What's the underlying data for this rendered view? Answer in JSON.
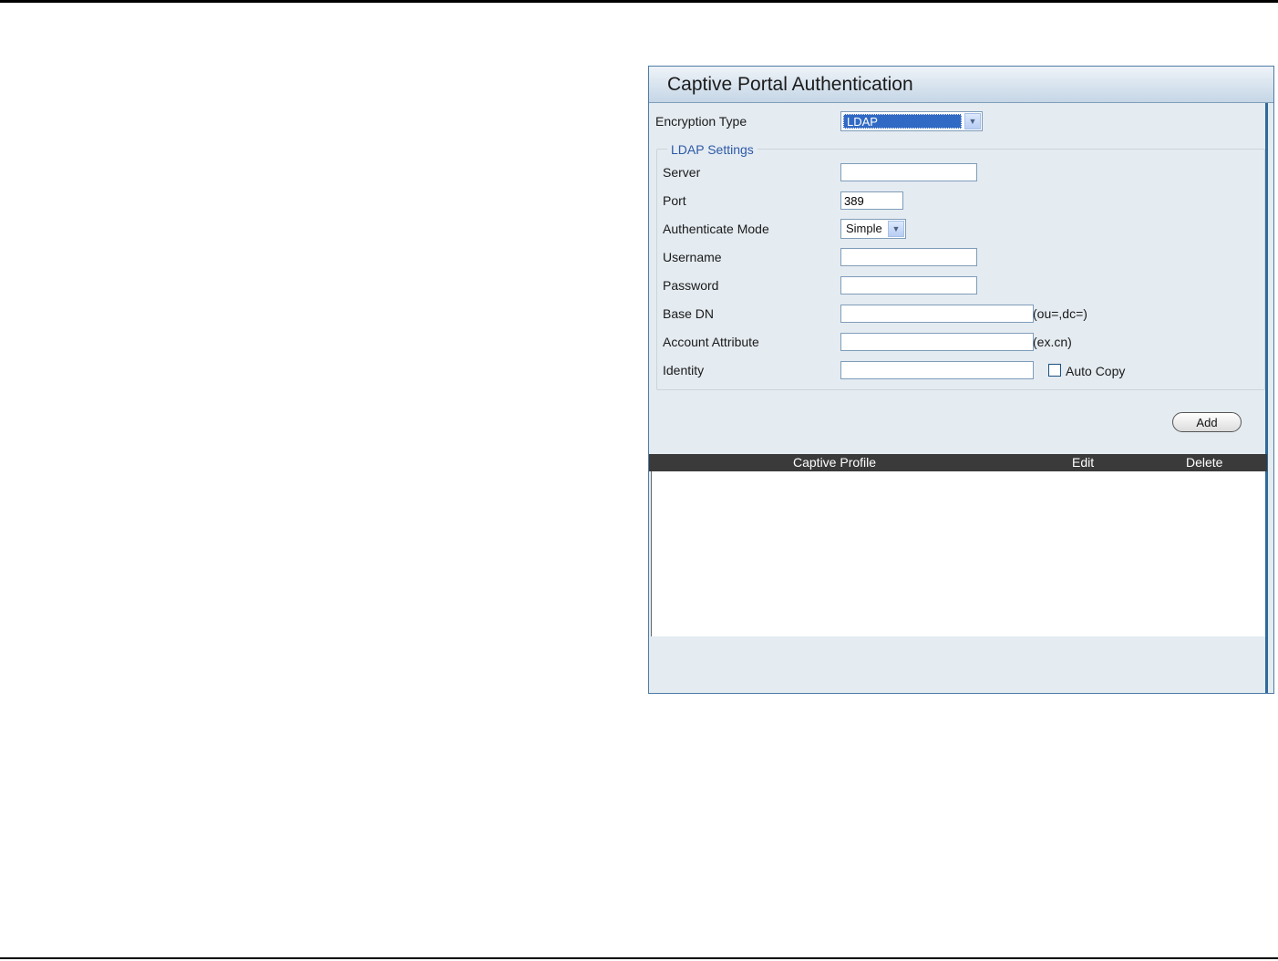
{
  "panel": {
    "title": "Captive Portal Authentication"
  },
  "encryption": {
    "label": "Encryption Type",
    "selected": "LDAP"
  },
  "ldap": {
    "legend": "LDAP Settings",
    "server": {
      "label": "Server",
      "value": ""
    },
    "port": {
      "label": "Port",
      "value": "389"
    },
    "auth_mode": {
      "label": "Authenticate Mode",
      "selected": "Simple"
    },
    "username": {
      "label": "Username",
      "value": ""
    },
    "password": {
      "label": "Password",
      "value": ""
    },
    "base_dn": {
      "label": "Base DN",
      "value": "",
      "hint": "(ou=,dc=)"
    },
    "account_attribute": {
      "label": "Account Attribute",
      "value": "",
      "hint": "(ex.cn)"
    },
    "identity": {
      "label": "Identity",
      "value": ""
    },
    "auto_copy": {
      "label": "Auto Copy",
      "checked": false
    }
  },
  "add_button": "Add",
  "table": {
    "headers": [
      "Captive Profile",
      "Edit",
      "Delete"
    ],
    "rows": []
  }
}
